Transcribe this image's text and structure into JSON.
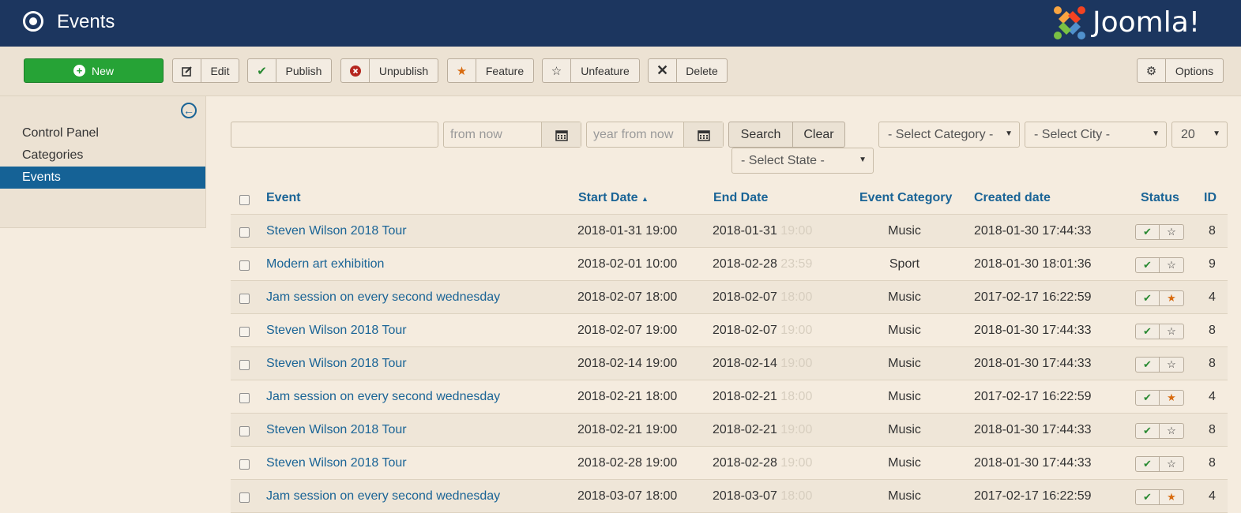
{
  "header": {
    "title": "Events",
    "logo_text": "Joomla!"
  },
  "toolbar": {
    "new": "New",
    "edit": "Edit",
    "publish": "Publish",
    "unpublish": "Unpublish",
    "feature": "Feature",
    "unfeature": "Unfeature",
    "delete": "Delete",
    "options": "Options"
  },
  "sidebar": {
    "items": [
      {
        "label": "Control Panel"
      },
      {
        "label": "Categories"
      },
      {
        "label": "Events"
      }
    ]
  },
  "filters": {
    "search_value": "",
    "from_placeholder": "from now",
    "to_placeholder": "year from now",
    "search_label": "Search",
    "clear_label": "Clear",
    "category": "- Select Category -",
    "city": "- Select City -",
    "limit": "20",
    "state": "- Select State -"
  },
  "table": {
    "headers": {
      "event": "Event",
      "start": "Start Date",
      "end": "End Date",
      "category": "Event Category",
      "created": "Created date",
      "status": "Status",
      "id": "ID"
    },
    "rows": [
      {
        "event": "Steven Wilson 2018 Tour",
        "start": "2018-01-31 19:00",
        "end_date": "2018-01-31",
        "end_time": "19:00",
        "category": "Music",
        "created": "2018-01-30 17:44:33",
        "featured": false,
        "id": "8"
      },
      {
        "event": "Modern art exhibition",
        "start": "2018-02-01 10:00",
        "end_date": "2018-02-28",
        "end_time": "23:59",
        "category": "Sport",
        "created": "2018-01-30 18:01:36",
        "featured": false,
        "id": "9"
      },
      {
        "event": "Jam session on every second wednesday",
        "start": "2018-02-07 18:00",
        "end_date": "2018-02-07",
        "end_time": "18:00",
        "category": "Music",
        "created": "2017-02-17 16:22:59",
        "featured": true,
        "id": "4"
      },
      {
        "event": "Steven Wilson 2018 Tour",
        "start": "2018-02-07 19:00",
        "end_date": "2018-02-07",
        "end_time": "19:00",
        "category": "Music",
        "created": "2018-01-30 17:44:33",
        "featured": false,
        "id": "8"
      },
      {
        "event": "Steven Wilson 2018 Tour",
        "start": "2018-02-14 19:00",
        "end_date": "2018-02-14",
        "end_time": "19:00",
        "category": "Music",
        "created": "2018-01-30 17:44:33",
        "featured": false,
        "id": "8"
      },
      {
        "event": "Jam session on every second wednesday",
        "start": "2018-02-21 18:00",
        "end_date": "2018-02-21",
        "end_time": "18:00",
        "category": "Music",
        "created": "2017-02-17 16:22:59",
        "featured": true,
        "id": "4"
      },
      {
        "event": "Steven Wilson 2018 Tour",
        "start": "2018-02-21 19:00",
        "end_date": "2018-02-21",
        "end_time": "19:00",
        "category": "Music",
        "created": "2018-01-30 17:44:33",
        "featured": false,
        "id": "8"
      },
      {
        "event": "Steven Wilson 2018 Tour",
        "start": "2018-02-28 19:00",
        "end_date": "2018-02-28",
        "end_time": "19:00",
        "category": "Music",
        "created": "2018-01-30 17:44:33",
        "featured": false,
        "id": "8"
      },
      {
        "event": "Jam session on every second wednesday",
        "start": "2018-03-07 18:00",
        "end_date": "2018-03-07",
        "end_time": "18:00",
        "category": "Music",
        "created": "2017-02-17 16:22:59",
        "featured": true,
        "id": "4"
      }
    ]
  },
  "colors": {
    "header_bg": "#1c365f",
    "link": "#1a6496",
    "new_button": "#26a336",
    "active_sidebar": "#156296",
    "featured_star": "#d86b10"
  }
}
